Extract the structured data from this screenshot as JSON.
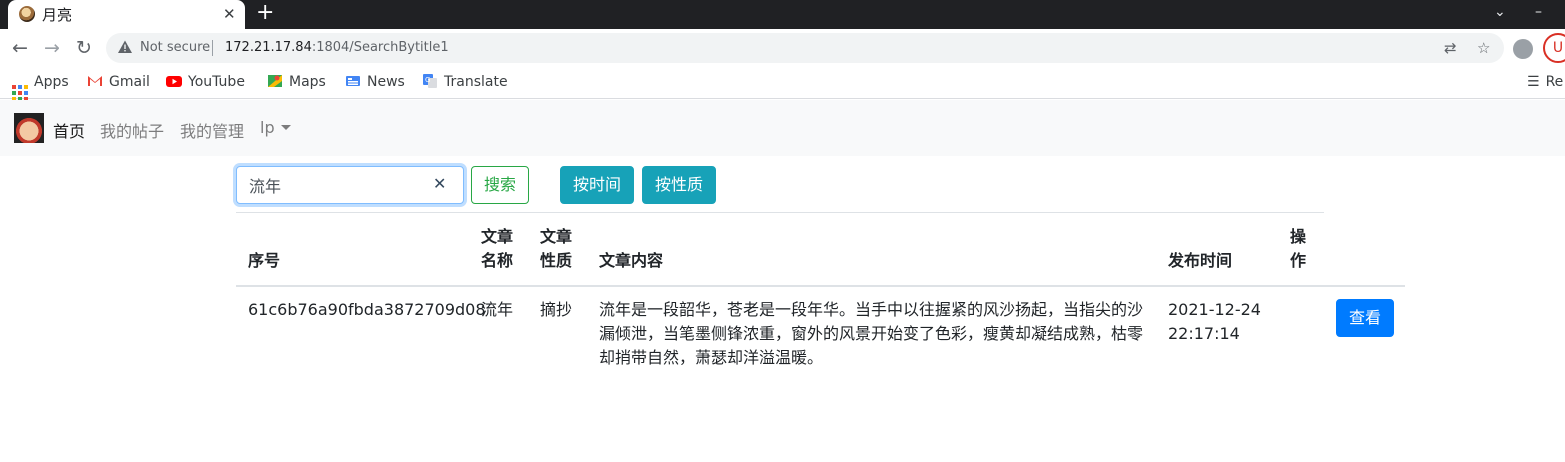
{
  "browser": {
    "tab_title": "月亮",
    "new_tab_icon": "plus-icon",
    "address": {
      "security_label": "Not secure",
      "host": "172.21.17.84",
      "path": ":1804/SearchBytitle1"
    },
    "profile_ext_label": "U",
    "reading_list_label": "Re",
    "bookmarks": [
      {
        "label": "Apps",
        "icon": "apps-grid-icon"
      },
      {
        "label": "Gmail",
        "icon": "gmail-icon"
      },
      {
        "label": "YouTube",
        "icon": "youtube-icon"
      },
      {
        "label": "Maps",
        "icon": "maps-icon"
      },
      {
        "label": "News",
        "icon": "news-icon"
      },
      {
        "label": "Translate",
        "icon": "translate-icon"
      }
    ]
  },
  "navbar": {
    "links": [
      {
        "label": "首页"
      },
      {
        "label": "我的帖子"
      },
      {
        "label": "我的管理"
      },
      {
        "label": "lp"
      }
    ]
  },
  "search": {
    "value": "流年",
    "search_button": "搜索",
    "by_time_button": "按时间",
    "by_type_button": "按性质"
  },
  "table": {
    "headers": {
      "id": "序号",
      "name_line1": "文章",
      "name_line2": "名称",
      "type_line1": "文章",
      "type_line2": "性质",
      "content": "文章内容",
      "time": "发布时间",
      "action_line1": "操",
      "action_line2": "作"
    },
    "rows": [
      {
        "id": "61c6b76a90fbda3872709d08",
        "name": "流年",
        "type": "摘抄",
        "content_line1": "流年是一段韶华，苍老是一段年华。当手中以往握紧的风沙扬起，当指尖的沙",
        "content_line2": "漏倾泄，当笔墨侧锋浓重，窗外的风景开始变了色彩，瘦黄却凝结成熟，枯零",
        "content_line3": "却捎带自然，萧瑟却洋溢温暖。",
        "date": "2021-12-24",
        "time": "22:17:14",
        "action": "查看"
      }
    ]
  },
  "colors": {
    "primary": "#007bff",
    "info": "#17a2b8",
    "success": "#28a745",
    "navbar_bg": "#f8f9fa"
  }
}
